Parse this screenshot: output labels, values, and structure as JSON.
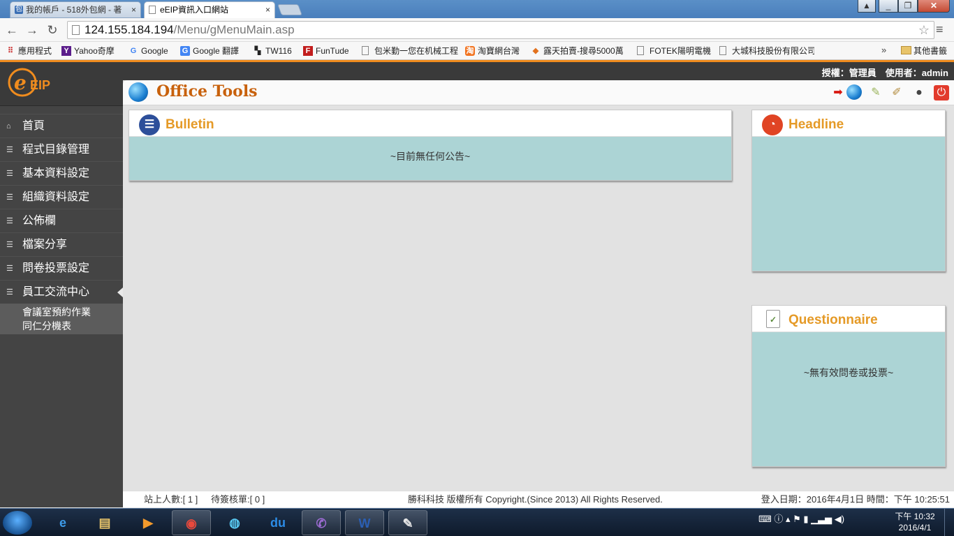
{
  "browser": {
    "tabs": [
      {
        "title": "我的帳戶 - 518外包網 - 著",
        "active": false
      },
      {
        "title": "eEIP資訊入口網站",
        "active": true
      }
    ],
    "close_glyph": "×",
    "address": {
      "host": "124.155.184.194",
      "path": "/Menu/gMenuMain.asp"
    },
    "bookmarks": [
      {
        "label": "應用程式",
        "icon": "apps-grid-icon"
      },
      {
        "label": "Yahoo奇摩",
        "icon": "yahoo-icon"
      },
      {
        "label": "Google",
        "icon": "google-icon"
      },
      {
        "label": "Google 翻譯",
        "icon": "google-translate-icon"
      },
      {
        "label": "TW116",
        "icon": "clapper-icon"
      },
      {
        "label": "FunTude",
        "icon": "funtude-icon"
      },
      {
        "label": "包米勤一您在机械工程",
        "icon": "page-icon"
      },
      {
        "label": "淘寶網台灣",
        "icon": "taobao-icon"
      },
      {
        "label": "露天拍賣-搜尋5000萬",
        "icon": "ruten-icon"
      },
      {
        "label": "FOTEK陽明電機",
        "icon": "page-icon"
      },
      {
        "label": "大城科技股份有限公司",
        "icon": "page-icon"
      }
    ],
    "bookmarks_more": "»",
    "other_bookmarks": "其他書籤"
  },
  "app": {
    "logo_text": "eEIP",
    "user_info": "授權：管理員　使用者：admin",
    "page_title": "Office Tools",
    "menu": [
      {
        "label": "首頁",
        "icon": "home-icon"
      },
      {
        "label": "程式目錄管理",
        "icon": "list-icon"
      },
      {
        "label": "基本資料設定",
        "icon": "list-icon"
      },
      {
        "label": "組織資料設定",
        "icon": "list-icon"
      },
      {
        "label": "公佈欄",
        "icon": "list-icon"
      },
      {
        "label": "檔案分享",
        "icon": "list-icon"
      },
      {
        "label": "問卷投票設定",
        "icon": "list-icon"
      },
      {
        "label": "員工交流中心",
        "icon": "list-icon"
      }
    ],
    "submenu": [
      "會議室預約作業",
      "同仁分機表"
    ],
    "bulletin": {
      "title": "Bulletin",
      "empty_msg": "~目前無任何公告~"
    },
    "headline": {
      "title": "Headline"
    },
    "questionnaire": {
      "title": "Questionnaire",
      "empty_msg": "~無有效問卷或投票~"
    },
    "footer": {
      "online": "站上人數:[ 1 ]",
      "pending": "待簽核單:[ 0 ]",
      "copyright": "勝科科技 版權所有 Copyright.(Since 2013) All Rights Reserved.",
      "login": "登入日期：2016年4月1日  時間：下午 10:25:51"
    }
  },
  "taskbar": {
    "apps": [
      "internet-explorer-icon",
      "explorer-icon",
      "media-player-icon",
      "chrome-icon",
      "globe-app-icon",
      "baidu-icon",
      "viber-icon",
      "word-icon",
      "paint-icon"
    ],
    "clock_time": "下午 10:32",
    "clock_date": "2016/4/1"
  },
  "colors": {
    "accent_orange": "#f08c1e",
    "title_orange": "#c8610c",
    "panel_teal": "#acd4d5",
    "sidebar": "#444444"
  }
}
